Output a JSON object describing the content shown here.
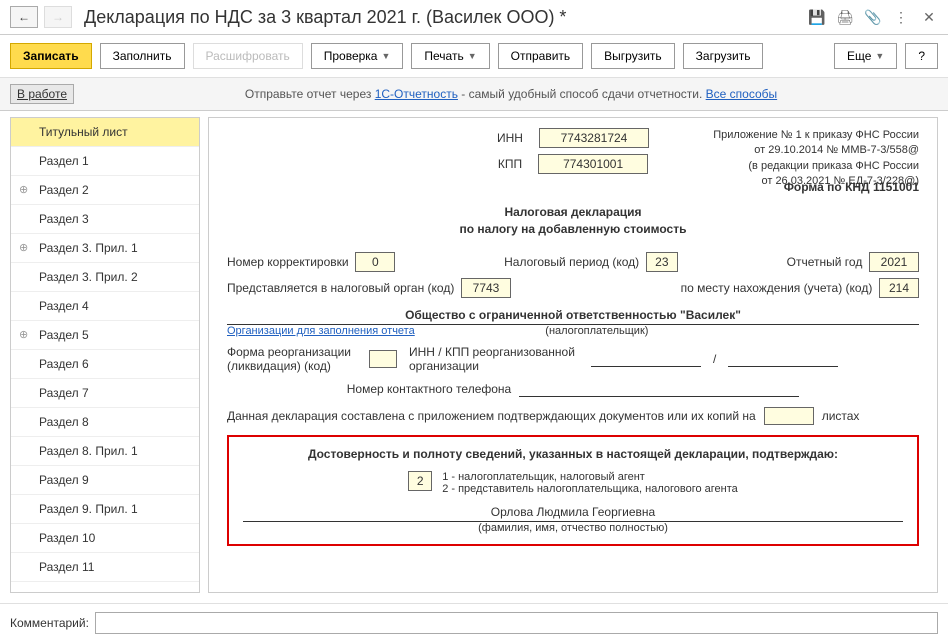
{
  "title": "Декларация по НДС за 3 квартал 2021 г. (Василек ООО) *",
  "nav": {
    "back": "←",
    "forward": "→"
  },
  "titleIcons": {
    "save": "💾",
    "print": "🖨",
    "attach": "📎",
    "more": "⋮",
    "close": "✕"
  },
  "toolbar": {
    "write": "Записать",
    "fill": "Заполнить",
    "decode": "Расшифровать",
    "check": "Проверка",
    "print": "Печать",
    "send": "Отправить",
    "upload": "Выгрузить",
    "load": "Загрузить",
    "more": "Еще",
    "help": "?"
  },
  "infobar": {
    "status": "В работе",
    "text1": "Отправьте отчет через ",
    "link1": "1С-Отчетность",
    "text2": " - самый удобный способ сдачи отчетности. ",
    "link2": "Все способы"
  },
  "sidebar": [
    {
      "label": "Титульный лист",
      "active": true
    },
    {
      "label": "Раздел 1"
    },
    {
      "label": "Раздел 2",
      "expand": true
    },
    {
      "label": "Раздел 3"
    },
    {
      "label": "Раздел 3. Прил. 1",
      "expand": true
    },
    {
      "label": "Раздел 3. Прил. 2"
    },
    {
      "label": "Раздел 4"
    },
    {
      "label": "Раздел 5",
      "expand": true
    },
    {
      "label": "Раздел 6"
    },
    {
      "label": "Раздел 7"
    },
    {
      "label": "Раздел 8"
    },
    {
      "label": "Раздел 8. Прил. 1"
    },
    {
      "label": "Раздел 9"
    },
    {
      "label": "Раздел 9. Прил. 1"
    },
    {
      "label": "Раздел 10"
    },
    {
      "label": "Раздел 11"
    }
  ],
  "form": {
    "innLabel": "ИНН",
    "inn": "7743281724",
    "kppLabel": "КПП",
    "kpp": "774301001",
    "appendix1": "Приложение № 1 к приказу ФНС России",
    "appendix2": "от 29.10.2014 № ММВ-7-3/558@",
    "appendix3": "(в редакции приказа ФНС России",
    "appendix4": "от 26.03.2021 № ЕД-7-3/228@)",
    "formCode": "Форма по КНД 1151001",
    "mainTitle1": "Налоговая декларация",
    "mainTitle2": "по налогу на добавленную стоимость",
    "corrLabel": "Номер корректировки",
    "corr": "0",
    "periodLabel": "Налоговый период (код)",
    "period": "23",
    "yearLabel": "Отчетный год",
    "year": "2021",
    "taxOrgLabel": "Представляется в налоговый орган (код)",
    "taxOrg": "7743",
    "locationLabel": "по месту нахождения (учета) (код)",
    "location": "214",
    "orgName": "Общество с ограниченной ответственностью \"Василек\"",
    "orgLink": "Организации для заполнения отчета",
    "orgSub": "(налогоплательщик)",
    "reorgLabel1": "Форма реорганизации",
    "reorgLabel2": "(ликвидация) (код)",
    "reorgInnLabel1": "ИНН / КПП реорганизованной",
    "reorgInnLabel2": "организации",
    "phoneLabel": "Номер контактного телефона",
    "docsLabel1": "Данная декларация составлена с приложением подтверждающих документов или их копий на",
    "docsLabel2": "листах",
    "confirmTitle": "Достоверность и полноту сведений, указанных в настоящей декларации, подтверждаю:",
    "confirmCode": "2",
    "confirmOpt1": "1 - налогоплательщик, налоговый агент",
    "confirmOpt2": "2 - представитель налогоплательщика, налогового агента",
    "signName": "Орлова Людмила Георгиевна",
    "signSub": "(фамилия, имя, отчество полностью)"
  },
  "footer": {
    "label": "Комментарий:"
  }
}
